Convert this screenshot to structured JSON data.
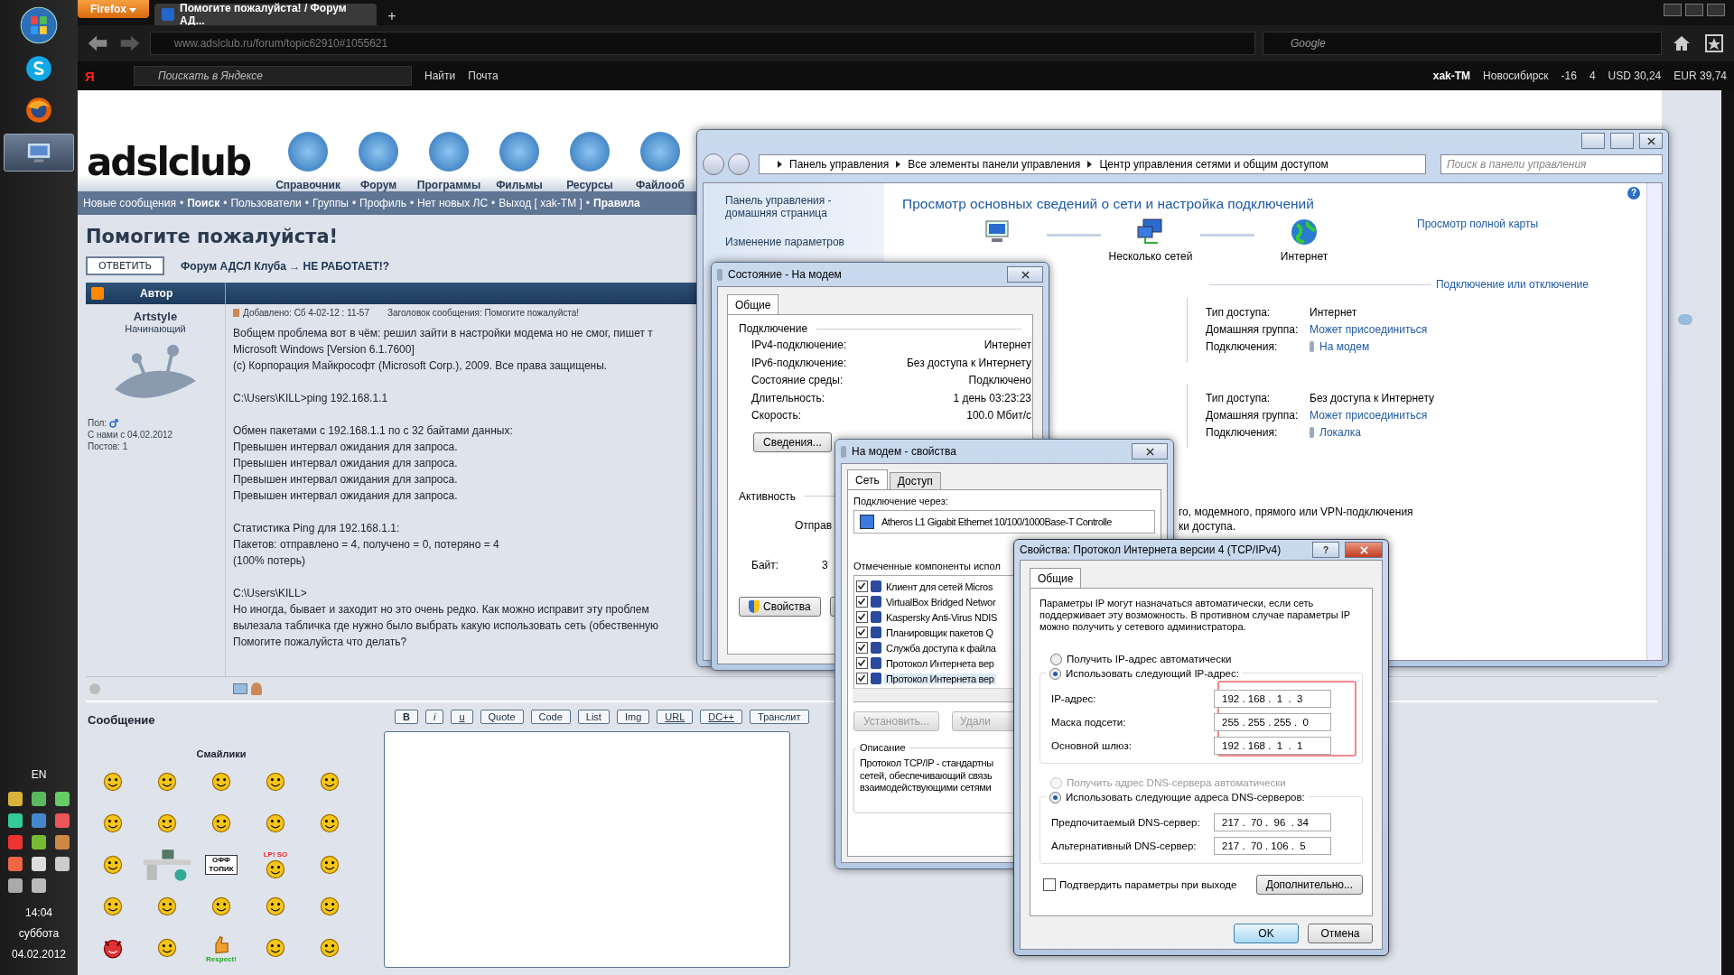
{
  "taskbar": {
    "apps": [
      {
        "kind": "skype",
        "selected": false
      },
      {
        "kind": "firefox",
        "selected": false
      },
      {
        "kind": "network",
        "selected": true
      }
    ],
    "language": "EN",
    "time": "14:04",
    "weekday": "суббота",
    "date": "04.02.2012"
  },
  "browser": {
    "menu_button": "Firefox",
    "tab_title": "Помогите пожалуйста! / Форум АД...",
    "new_tab": "+",
    "url": "www.adslclub.ru/forum/topic62910#1055621",
    "search_engine": "Google"
  },
  "yandex_bar": {
    "brand": "Я",
    "search_placeholder": "Поискать в Яндексе",
    "find": "Найти",
    "mail": "Почта",
    "user": "xak-TM",
    "city": "Новосибирск",
    "temperature": "-16",
    "traffic": "4",
    "usd": "USD 30,24",
    "eur": "EUR 39,74"
  },
  "site": {
    "logo": "adslclub",
    "nav": [
      "Справочник",
      "Форум",
      "Программы",
      "Фильмы",
      "Ресурсы",
      "Файлооб"
    ],
    "separator": "•",
    "links": [
      {
        "label": "Новые сообщения",
        "bold": false
      },
      {
        "label": "Поиск",
        "bold": true
      },
      {
        "label": "Пользователи",
        "bold": false
      },
      {
        "label": "Группы",
        "bold": false
      },
      {
        "label": "Профиль",
        "bold": false
      },
      {
        "label": "Нет новых ЛС",
        "bold": false
      },
      {
        "label": "Выход [ xak-TM ]",
        "bold": false
      },
      {
        "label": "Правила",
        "bold": true
      }
    ],
    "topic_title": "Помогите пожалуйста!",
    "reply_button": "ОТВЕТИТЬ",
    "breadcrumb": "Форум АДСЛ Клуба → НЕ РАБОТАЕТ!?",
    "author_header": "Автор",
    "post": {
      "author": "Artstyle",
      "rank": "Начинающий",
      "gender_label": "Пол:",
      "joined": "С нами с 04.02.2012",
      "posts": "Постов: 1",
      "meta": "Добавлено: Сб 4-02-12 : 11-57",
      "subject": "Заголовок сообщения: Помогите пожалуйста!",
      "paragraphs": [
        [
          "Вобщем проблема вот в чём: решил зайти в настройки модема но не смог, пишет т",
          "Microsoft Windows [Version 6.1.7600]",
          "(c) Корпорация Майкрософт (Microsoft Corp.), 2009. Все права защищены."
        ],
        [
          "C:\\Users\\KILL>ping 192.168.1.1"
        ],
        [
          "Обмен пакетами с 192.168.1.1 по с 32 байтами данных:",
          "Превышен интервал ожидания для запроса.",
          "Превышен интервал ожидания для запроса.",
          "Превышен интервал ожидания для запроса.",
          "Превышен интервал ожидания для запроса."
        ],
        [
          "Статистика Ping для 192.168.1.1:",
          "Пакетов: отправлено = 4, получено = 0, потеряно = 4",
          "(100% потерь)"
        ],
        [
          "C:\\Users\\KILL>",
          "Но иногда, бывает и заходит но это очень редко. Как можно исправит эту проблем",
          "вылезала табличка где нужно было выбрать какую использовать сеть (обественную",
          "Помогите пожалуйста что делать?"
        ]
      ]
    },
    "message": {
      "label": "Сообщение",
      "smilies_title": "Смайлики",
      "smilies": [
        {
          "kind": "face"
        },
        {
          "kind": "face"
        },
        {
          "kind": "face"
        },
        {
          "kind": "face"
        },
        {
          "kind": "face"
        },
        {
          "kind": "face"
        },
        {
          "kind": "face"
        },
        {
          "kind": "face"
        },
        {
          "kind": "face"
        },
        {
          "kind": "face"
        },
        {
          "kind": "face"
        },
        {
          "kind": "desk"
        },
        {
          "kind": "sign",
          "caption": "ОФФ ТОПИК"
        },
        {
          "kind": "face",
          "caption": "LP! SO"
        },
        {
          "kind": "face"
        },
        {
          "kind": "face"
        },
        {
          "kind": "face"
        },
        {
          "kind": "face"
        },
        {
          "kind": "face"
        },
        {
          "kind": "face"
        },
        {
          "kind": "devil"
        },
        {
          "kind": "face"
        },
        {
          "kind": "thumb",
          "caption": "Respect!"
        },
        {
          "kind": "face"
        },
        {
          "kind": "face"
        }
      ],
      "bbcodes": [
        {
          "label": "B",
          "kind": "bold"
        },
        {
          "label": "i",
          "kind": "italic"
        },
        {
          "label": "u",
          "kind": "underline"
        },
        {
          "label": "Quote",
          "kind": "plain"
        },
        {
          "label": "Code",
          "kind": "plain"
        },
        {
          "label": "List",
          "kind": "plain"
        },
        {
          "label": "Img",
          "kind": "plain"
        },
        {
          "label": "URL",
          "kind": "underline"
        },
        {
          "label": "DC++",
          "kind": "underline"
        },
        {
          "label": "Транслит",
          "kind": "plain"
        }
      ]
    }
  },
  "control_panel": {
    "breadcrumb": [
      "Панель управления",
      "Все элементы панели управления",
      "Центр управления сетями и общим доступом"
    ],
    "search_placeholder": "Поиск в панели управления",
    "sidebar": [
      "Панель управления - домашняя страница",
      "Изменение параметров"
    ],
    "heading": "Просмотр основных сведений о сети и настройка подключений",
    "map": [
      {
        "kind": "computer"
      },
      {
        "kind": "networks",
        "label": "Несколько сетей"
      },
      {
        "kind": "globe",
        "label": "Интернет"
      }
    ],
    "help_button": "?",
    "full_map_link": "Просмотр полной карты",
    "connect_link": "Подключение или отключение",
    "networks": [
      [
        {
          "label": "Тип доступа:",
          "value": "Интернет",
          "kind": "text"
        },
        {
          "label": "Домашняя группа:",
          "value": "Может присоединиться",
          "kind": "link"
        },
        {
          "label": "Подключения:",
          "value": "На модем",
          "kind": "connection"
        }
      ],
      [
        {
          "label": "Тип доступа:",
          "value": "Без доступа к Интернету",
          "kind": "text"
        },
        {
          "label": "Домашняя группа:",
          "value": "Может присоединиться",
          "kind": "link"
        },
        {
          "label": "Подключения:",
          "value": "Локалка",
          "kind": "connection"
        }
      ]
    ],
    "partial_lines": [
      "го, модемного, прямого или VPN-подключения",
      "ки доступа."
    ]
  },
  "status_dialog": {
    "title": "Состояние - На модем",
    "tab": "Общие",
    "section": "Подключение",
    "rows": [
      {
        "label": "IPv4-подключение:",
        "value": "Интернет"
      },
      {
        "label": "IPv6-подключение:",
        "value": "Без доступа к Интернету"
      },
      {
        "label": "Состояние среды:",
        "value": "Подключено"
      },
      {
        "label": "Длительность:",
        "value": "1 день 03:23:23"
      },
      {
        "label": "Скорость:",
        "value": "100.0 Мбит/с"
      }
    ],
    "details_button": "Сведения...",
    "activity": "Активность",
    "sent": "Отправ",
    "bytes": "Байт:",
    "bytes_value": "3",
    "properties_button": "Свойства"
  },
  "props_dialog": {
    "title": "На модем - свойства",
    "tabs": [
      {
        "label": "Сеть",
        "selected": true
      },
      {
        "label": "Доступ",
        "selected": false
      }
    ],
    "connect_via": "Подключение через:",
    "adapter": "Atheros L1 Gigabit Ethernet 10/100/1000Base-T Controlle",
    "components_label": "Отмеченные компоненты испол",
    "components": [
      {
        "label": "Клиент для сетей Micros",
        "checked": true,
        "selected": false
      },
      {
        "label": "VirtualBox Bridged Networ",
        "checked": true,
        "selected": false
      },
      {
        "label": "Kaspersky Anti-Virus NDIS",
        "checked": true,
        "selected": false
      },
      {
        "label": "Планировщик пакетов Q",
        "checked": true,
        "selected": false
      },
      {
        "label": "Служба доступа к файла",
        "checked": true,
        "selected": false
      },
      {
        "label": "Протокол Интернета вер",
        "checked": true,
        "selected": false
      },
      {
        "label": "Протокол Интернета вер",
        "checked": true,
        "selected": true
      }
    ],
    "install_button": {
      "label": "Установить...",
      "disabled": true
    },
    "remove_button": {
      "label": "Удали",
      "disabled": true
    },
    "description_title": "Описание",
    "description": [
      "Протокол TCP/IP - стандартны",
      "сетей, обеспечивающий связь",
      "взаимодействующими сетями"
    ]
  },
  "tcp_dialog": {
    "title": "Свойства: Протокол Интернета версии 4 (TCP/IPv4)",
    "tab": "Общие",
    "intro": "Параметры IP могут назначаться автоматически, если сеть поддерживает эту возможность. В противном случае параметры IP можно получить у сетевого администратора.",
    "ip_radios": [
      {
        "label": "Получить IP-адрес автоматически",
        "selected": false,
        "disabled": false
      },
      {
        "label": "Использовать следующий IP-адрес:",
        "selected": true,
        "disabled": false
      }
    ],
    "ip_fields": [
      {
        "label": "IP-адрес:",
        "value": "192 . 168 .  1  .  3"
      },
      {
        "label": "Маска подсети:",
        "value": "255 . 255 . 255 .  0"
      },
      {
        "label": "Основной шлюз:",
        "value": "192 . 168 .  1  .  1"
      }
    ],
    "dns_radios": [
      {
        "label": "Получить адрес DNS-сервера автоматически",
        "selected": false,
        "disabled": true
      },
      {
        "label": "Использовать следующие адреса DNS-серверов:",
        "selected": true,
        "disabled": false
      }
    ],
    "dns_fields": [
      {
        "label": "Предпочитаемый DNS-сервер:",
        "value": "217 .  70 .  96  . 34"
      },
      {
        "label": "Альтернативный DNS-сервер:",
        "value": "217 .  70 . 106 .  5"
      }
    ],
    "confirm": {
      "label": "Подтвердить параметры при выходе",
      "checked": false
    },
    "help_button": "?",
    "advanced_button": "Дополнительно...",
    "ok_button": "OK",
    "cancel_button": "Отмена"
  }
}
